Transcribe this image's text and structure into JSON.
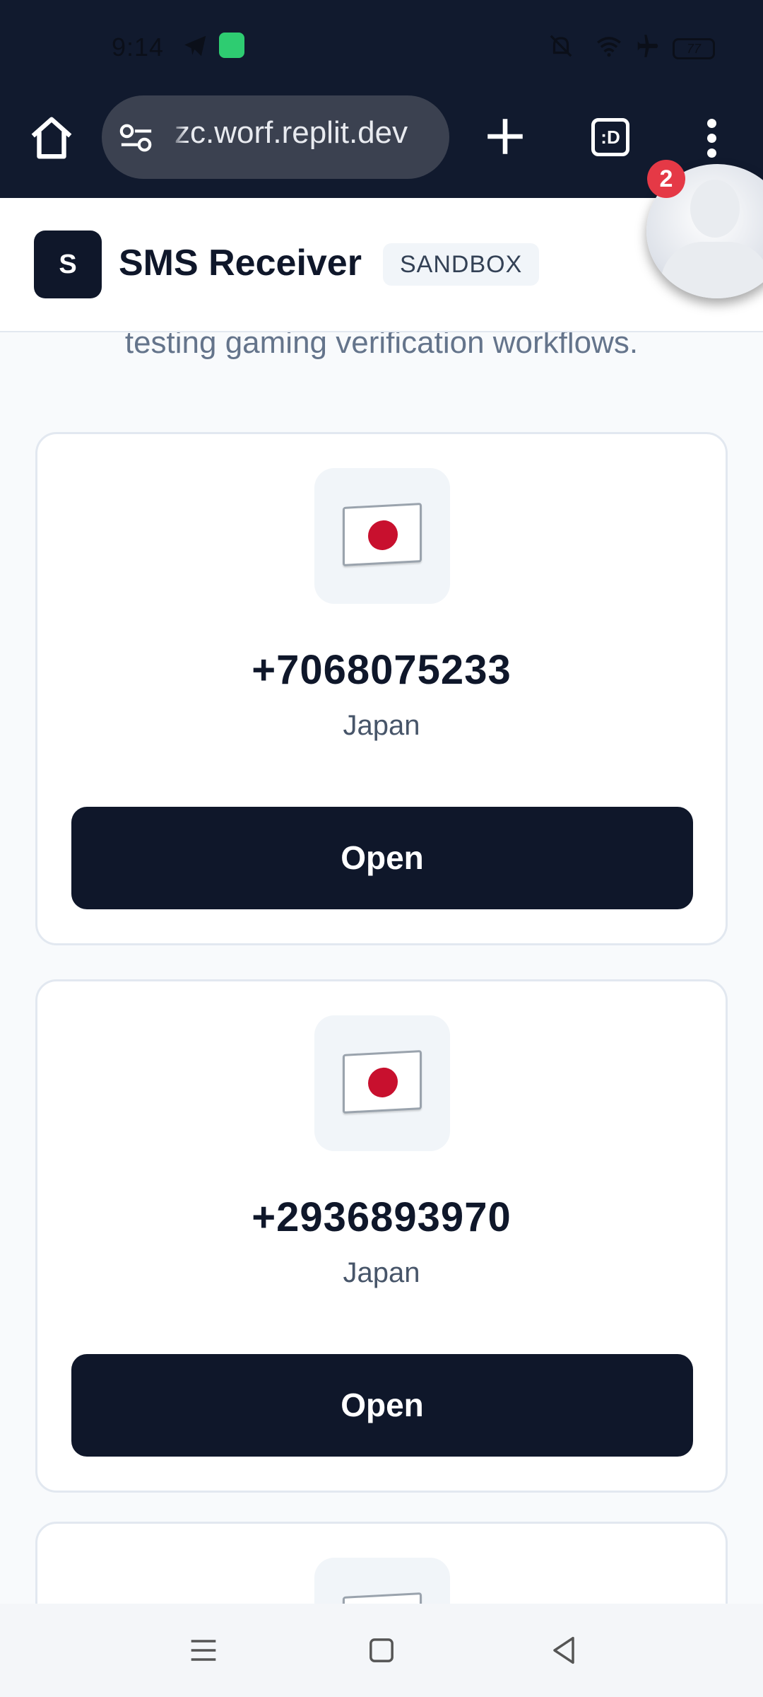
{
  "status_bar": {
    "time": "9:14",
    "battery": "77",
    "icons": [
      "telegram-icon",
      "android-icon",
      "mute-icon",
      "wifi-icon",
      "airplane-icon",
      "battery-icon"
    ]
  },
  "browser": {
    "url": "zc.worf.replit.dev",
    "tabs_label": ":D"
  },
  "page": {
    "ghost_line_1": "testing gaming verification workflows."
  },
  "header": {
    "logo_letter": "S",
    "title": "SMS Receiver",
    "badge": "SANDBOX"
  },
  "cards": [
    {
      "phone": "+7068075233",
      "country": "Japan",
      "button": "Open",
      "flag": "japan-flag-icon"
    },
    {
      "phone": "+2936893970",
      "country": "Japan",
      "button": "Open",
      "flag": "japan-flag-icon"
    }
  ],
  "bubble": {
    "count": "2"
  },
  "colors": {
    "top_bar": "#111a2e",
    "primary": "#0f172a",
    "badge_bg": "#f1f5f9",
    "notification": "#e53946",
    "flag_red": "#c8102e"
  }
}
